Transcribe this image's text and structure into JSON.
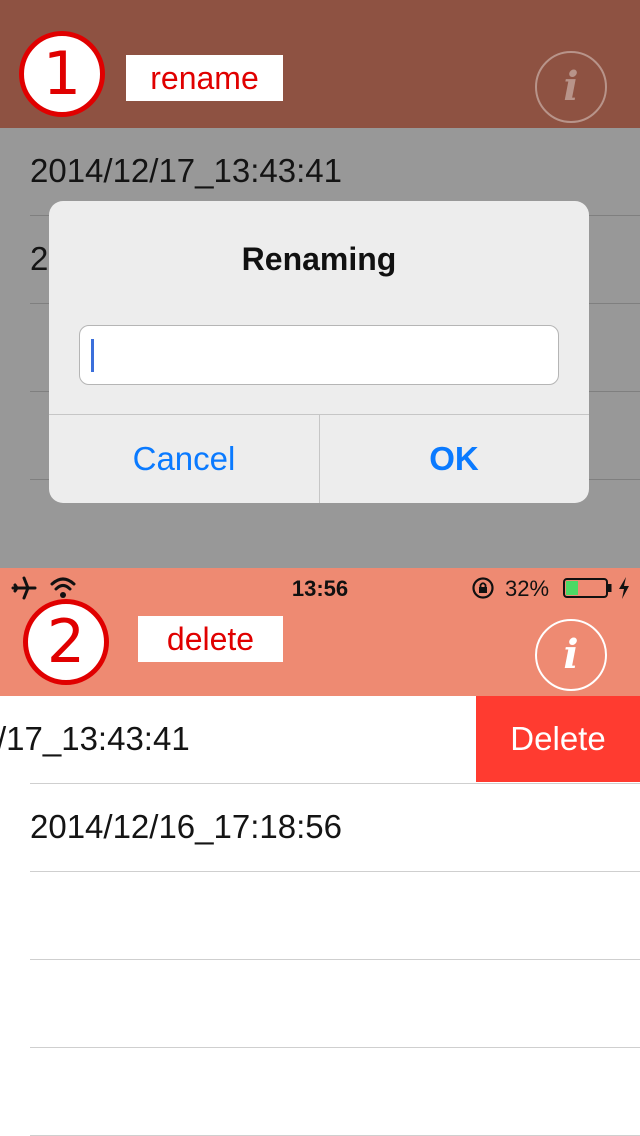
{
  "panel1": {
    "step_number": "1",
    "step_label": "rename",
    "info_icon": "info-icon",
    "rows": [
      {
        "text": "2014/12/17_13:43:41"
      },
      {
        "text": "2"
      },
      {
        "text": ""
      },
      {
        "text": ""
      },
      {
        "text": ""
      }
    ],
    "alert": {
      "title": "Renaming",
      "input_value": "",
      "cancel_label": "Cancel",
      "ok_label": "OK"
    },
    "colors": {
      "header": "#8e5242",
      "dim_background": "#989898",
      "alert_button": "#0a7aff"
    }
  },
  "panel2": {
    "status_bar": {
      "time": "13:56",
      "battery_percent": "32%",
      "icons": [
        "airplane-icon",
        "wifi-icon",
        "orientation-lock-icon",
        "battery-icon",
        "charging-icon"
      ],
      "battery_level": 0.32
    },
    "step_number": "2",
    "step_label": "delete",
    "info_icon": "info-icon",
    "rows": [
      {
        "text": "/17_13:43:41",
        "action": "Delete"
      },
      {
        "text": "2014/12/16_17:18:56"
      },
      {
        "text": ""
      },
      {
        "text": ""
      },
      {
        "text": ""
      }
    ],
    "colors": {
      "header": "#ee8a72",
      "delete": "#ff3b30"
    }
  },
  "annotation_color": "#e00000"
}
